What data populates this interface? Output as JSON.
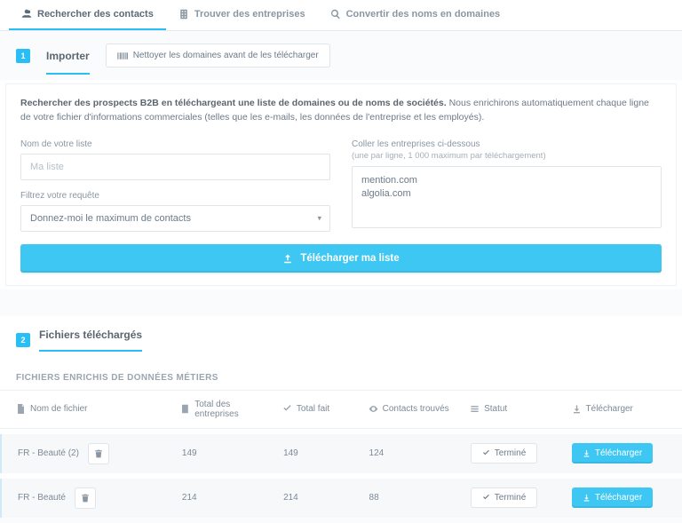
{
  "top_tabs": {
    "contacts": "Rechercher des contacts",
    "companies": "Trouver des entreprises",
    "convert": "Convertir des noms en domaines"
  },
  "step1": {
    "num": "1",
    "label": "Importer",
    "clean_btn": "Nettoyer les domaines avant de les télécharger"
  },
  "intro": {
    "bold": "Rechercher des prospects B2B en téléchargeant une liste de domaines ou de noms de sociétés.",
    "rest": " Nous enrichirons automatiquement chaque ligne de votre fichier d'informations commerciales (telles que les e-mails, les données de l'entreprise et les employés)."
  },
  "form": {
    "list_label": "Nom de votre liste",
    "list_placeholder": "Ma liste",
    "filter_label": "Filtrez votre requête",
    "filter_value": "Donnez-moi le maximum de contacts",
    "paste_label": "Coller les entreprises ci-dessous",
    "paste_hint": "(une par ligne, 1 000 maximum par téléchargement)",
    "paste_value": "mention.com\nalgolia.com",
    "upload_btn": "Télécharger ma liste"
  },
  "step2": {
    "num": "2",
    "label": "Fichiers téléchargés",
    "caption": "FICHIERS ENRICHIS DE DONNÉES MÉTIERS"
  },
  "columns": {
    "filename": "Nom de fichier",
    "total_companies": "Total des entreprises",
    "total_done": "Total fait",
    "contacts_found": "Contacts trouvés",
    "status": "Statut",
    "download": "Télécharger"
  },
  "status_done": "Terminé",
  "download_label": "Télécharger",
  "files": [
    {
      "name": "FR - Beauté (2)",
      "companies": "149",
      "done": "149",
      "contacts": "124"
    },
    {
      "name": "FR - Beauté",
      "companies": "214",
      "done": "214",
      "contacts": "88"
    }
  ]
}
